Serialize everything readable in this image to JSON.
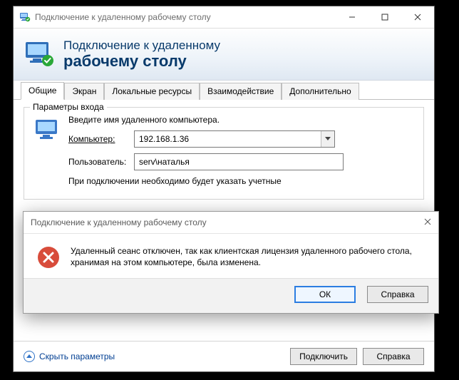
{
  "window": {
    "title": "Подключение к удаленному рабочему столу",
    "banner_line1": "Подключение к удаленному",
    "banner_line2": "рабочему столу"
  },
  "tabs": {
    "general": "Общие",
    "display": "Экран",
    "local": "Локальные ресурсы",
    "experience": "Взаимодействие",
    "advanced": "Дополнительно"
  },
  "login_group": {
    "title": "Параметры входа",
    "hint": "Введите имя удаленного компьютера.",
    "computer_label": "Компьютер:",
    "computer_value": "192.168.1.36",
    "user_label": "Пользователь:",
    "user_value": "serv\\наталья",
    "note": "При подключении необходимо будет указать учетные"
  },
  "footer": {
    "collapse": "Скрыть параметры",
    "connect": "Подключить",
    "help": "Справка"
  },
  "dialog": {
    "title": "Подключение к удаленному рабочему столу",
    "message": "Удаленный сеанс отключен, так как клиентская лицензия удаленного рабочего стола, хранимая на этом компьютере, была изменена.",
    "ok": "ОК",
    "help": "Справка"
  }
}
